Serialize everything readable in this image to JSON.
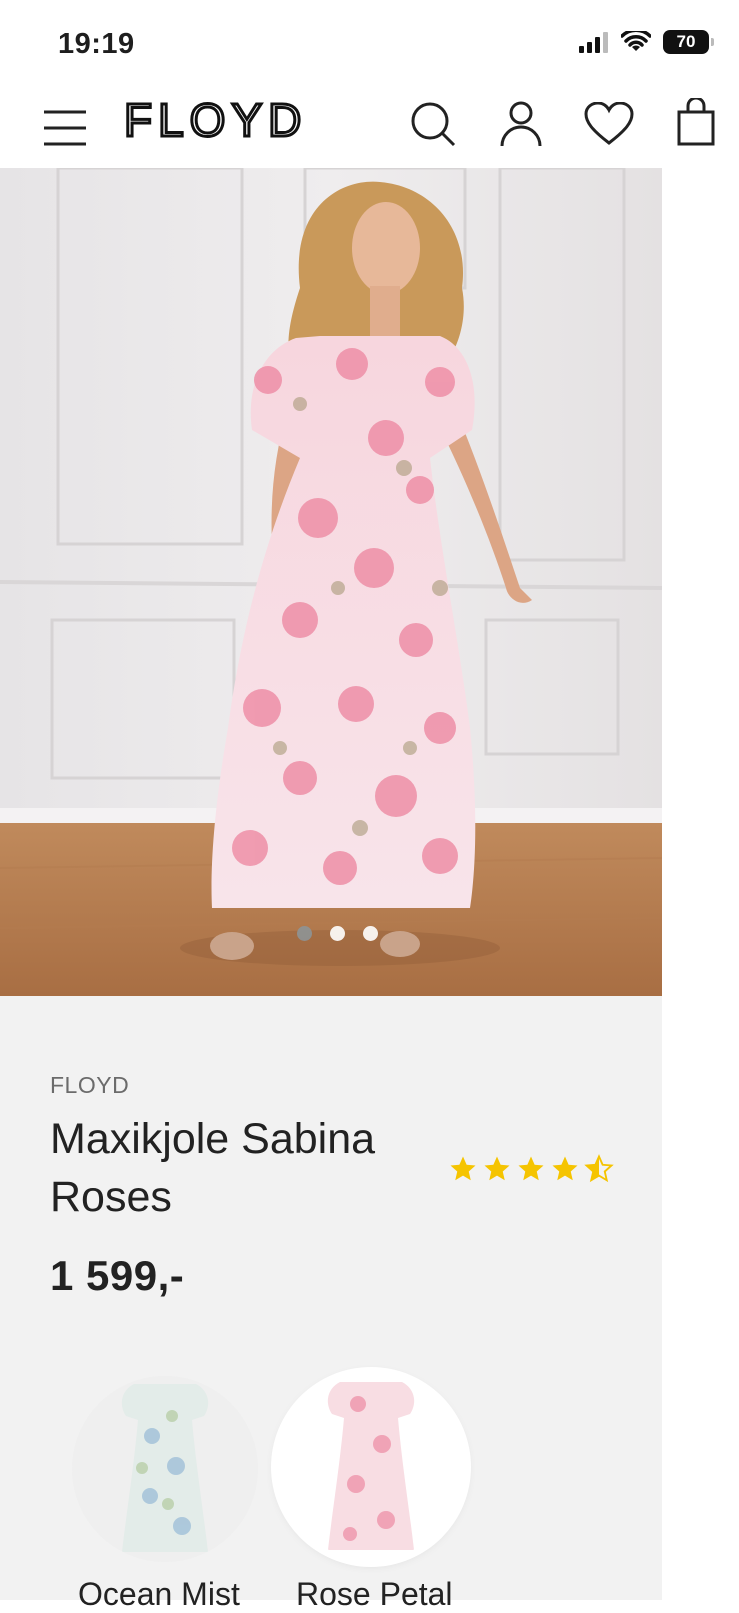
{
  "status_bar": {
    "time": "19:19",
    "battery": "70"
  },
  "header": {
    "logo": "FLOYD",
    "icons": [
      "menu-icon",
      "search-icon",
      "account-icon",
      "heart-icon",
      "bag-icon"
    ]
  },
  "gallery": {
    "image_count": 3,
    "active_index": 0
  },
  "product": {
    "brand": "FLOYD",
    "title": "Maxikjole Sabina Roses",
    "rating": 4.5,
    "price": "1 599,-"
  },
  "variants": [
    {
      "label": "Ocean Mist",
      "selected": false,
      "color": "#dfe9ef"
    },
    {
      "label": "Rose Petal",
      "selected": true,
      "color": "#f5c9d3"
    }
  ],
  "colors": {
    "accent_star": "#f5c400",
    "page_bg": "#f2f2f2"
  }
}
